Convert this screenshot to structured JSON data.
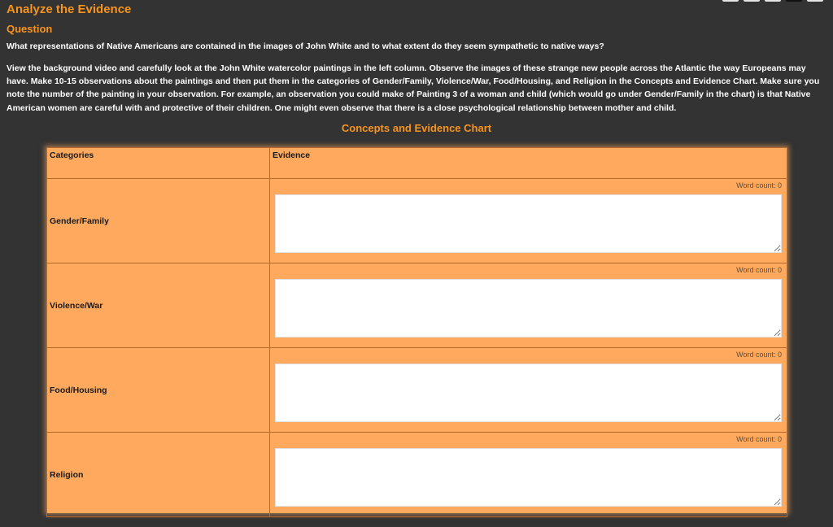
{
  "header": {
    "title": "Analyze the Evidence",
    "section": "Question"
  },
  "question": "What representations of Native Americans are contained in the images of John White and to what extent do they seem sympathetic to native ways?",
  "instructions": "View the background video and carefully look at the John White watercolor paintings in the left column. Observe the images of these strange new people across the Atlantic the way Europeans may have. Make 10-15 observations about the paintings and then put them in the categories of Gender/Family, Violence/War, Food/Housing, and Religion in the Concepts and Evidence Chart. Make sure you note the number of the painting in your observation. For example, an observation you could make of Painting 3 of a woman and child (which would go under Gender/Family in the chart) is that Native American women are careful with and protective of their children. One might even observe that there is a close psychological relationship between mother and child.",
  "chart": {
    "title": "Concepts and Evidence Chart",
    "col_categories": "Categories",
    "col_evidence": "Evidence",
    "word_count_label": "Word count:",
    "rows": [
      {
        "category": "Gender/Family",
        "word_count": "0",
        "value": ""
      },
      {
        "category": "Violence/War",
        "word_count": "0",
        "value": ""
      },
      {
        "category": "Food/Housing",
        "word_count": "0",
        "value": ""
      },
      {
        "category": "Religion",
        "word_count": "0",
        "value": ""
      }
    ]
  }
}
